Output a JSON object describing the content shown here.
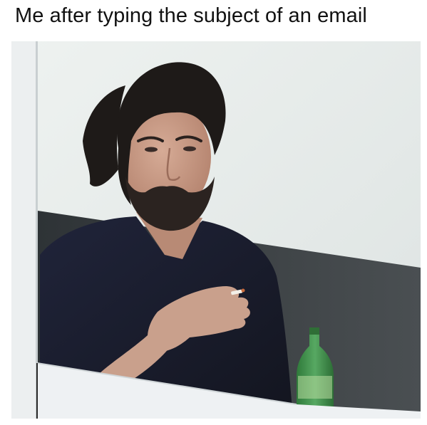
{
  "meme": {
    "caption": "Me after typing the subject of an email"
  },
  "photo": {
    "subject": "bearded-man-holding-cigarette",
    "colors": {
      "sky": "#e7ecea",
      "wall": "#3a3f42",
      "shirt": "#1a1d2e",
      "skin": "#c79a85",
      "hair": "#1e1a18",
      "bottle": "#3f8f4a",
      "ledge": "#eef1f3"
    }
  }
}
